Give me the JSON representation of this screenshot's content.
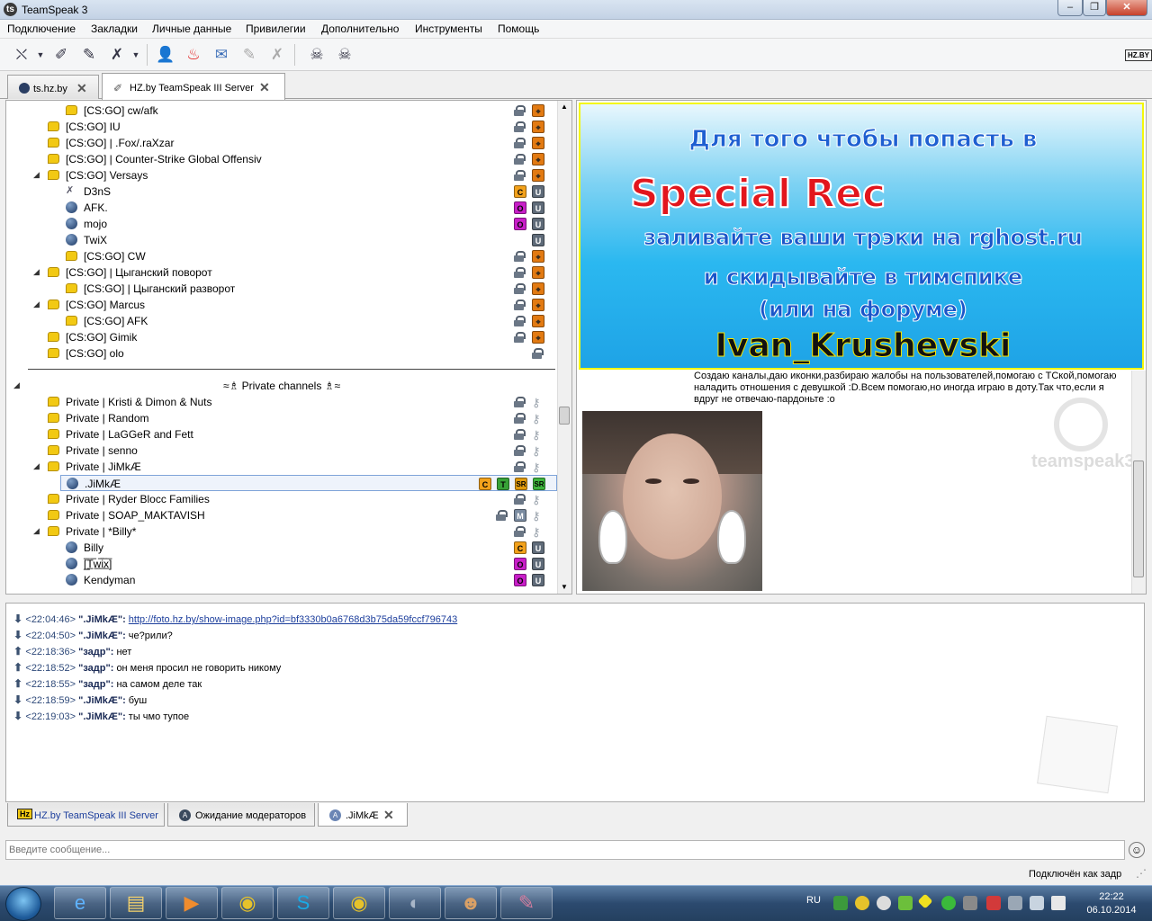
{
  "window": {
    "title": "TeamSpeak 3"
  },
  "menu": [
    "Подключение",
    "Закладки",
    "Личные данные",
    "Привилегии",
    "Дополнительно",
    "Инструменты",
    "Помощь"
  ],
  "toolbar_icons": [
    "connect-icon",
    "disconnect-icon",
    "away-icon",
    "mute-mic-icon",
    "mute-speaker-icon",
    "contacts-icon",
    "fire-icon",
    "chat-icon",
    "register-icon",
    "unregister-icon",
    "bug-icon",
    "bug2-icon"
  ],
  "toolbar_brand": "HZ.BY",
  "server_tabs": [
    {
      "label": "ts.hz.by"
    },
    {
      "label": "HZ.by TeamSpeak III Server"
    }
  ],
  "tree": [
    {
      "label": "[CS:GO] cw/afk",
      "kind": "channel",
      "indent": 2,
      "arrow": ""
    },
    {
      "label": "[CS:GO] IU",
      "kind": "channel",
      "indent": 1,
      "arrow": ""
    },
    {
      "label": "[CS:GO] | .Fox/.raXzar",
      "kind": "channel",
      "indent": 1,
      "arrow": ""
    },
    {
      "label": "[CS:GO] | Counter-Strike Global Offensiv",
      "kind": "channel",
      "indent": 1,
      "arrow": ""
    },
    {
      "label": "[CS:GO] Versays",
      "kind": "channel",
      "indent": 1,
      "arrow": "◢"
    },
    {
      "label": "D3nS",
      "kind": "user-muted",
      "indent": 2,
      "arrow": ""
    },
    {
      "label": "AFK.",
      "kind": "user",
      "indent": 2,
      "arrow": ""
    },
    {
      "label": "mojo",
      "kind": "user",
      "indent": 2,
      "arrow": ""
    },
    {
      "label": "TwiX",
      "kind": "user",
      "indent": 2,
      "arrow": ""
    },
    {
      "label": "[CS:GO] CW",
      "kind": "channel",
      "indent": 2,
      "arrow": ""
    },
    {
      "label": "[CS:GO] | Цыганский поворот",
      "kind": "channel",
      "indent": 1,
      "arrow": "◢"
    },
    {
      "label": "[CS:GO] | Цыганский разворот",
      "kind": "channel",
      "indent": 2,
      "arrow": ""
    },
    {
      "label": "[CS:GO] Marcus",
      "kind": "channel",
      "indent": 1,
      "arrow": "◢"
    },
    {
      "label": "[CS:GO] AFK",
      "kind": "channel",
      "indent": 2,
      "arrow": ""
    },
    {
      "label": "[CS:GO] Gimik",
      "kind": "channel",
      "indent": 1,
      "arrow": ""
    },
    {
      "label": "[CS:GO] olo",
      "kind": "channel",
      "indent": 1,
      "arrow": ""
    },
    {
      "label": "",
      "kind": "spacer",
      "indent": 0,
      "arrow": ""
    },
    {
      "label": "≈♗ Private channels ♗≈",
      "kind": "spacer-label",
      "indent": 0,
      "arrow": "◢"
    },
    {
      "label": "Private | Kristi & Dimon & Nuts",
      "kind": "channel",
      "indent": 1,
      "arrow": ""
    },
    {
      "label": "Private | Random",
      "kind": "channel",
      "indent": 1,
      "arrow": ""
    },
    {
      "label": "Private | LaGGeR and Fett",
      "kind": "channel",
      "indent": 1,
      "arrow": ""
    },
    {
      "label": "Private | senno",
      "kind": "channel",
      "indent": 1,
      "arrow": ""
    },
    {
      "label": "Private | JiMkÆ",
      "kind": "channel",
      "indent": 1,
      "arrow": "◢"
    },
    {
      "label": ".JiMkÆ",
      "kind": "user-selected",
      "indent": 2,
      "arrow": ""
    },
    {
      "label": "Private | Ryder Blocc Families",
      "kind": "channel",
      "indent": 1,
      "arrow": ""
    },
    {
      "label": "Private | SOAP_MAKTAVISH",
      "kind": "channel",
      "indent": 1,
      "arrow": ""
    },
    {
      "label": "Private | *Billy*",
      "kind": "channel",
      "indent": 1,
      "arrow": "◢"
    },
    {
      "label": "Billy",
      "kind": "user",
      "indent": 2,
      "arrow": ""
    },
    {
      "label": "[̲̅T̲̅w̲̅i̲̅x̲̅]",
      "kind": "user",
      "indent": 2,
      "arrow": ""
    },
    {
      "label": "Kendyman",
      "kind": "user",
      "indent": 2,
      "arrow": ""
    }
  ],
  "badges": {
    "row0": [
      "lock",
      "k"
    ],
    "row1": [
      "lock",
      "k"
    ],
    "row2": [
      "lock",
      "k"
    ],
    "row3": [
      "lock",
      "k"
    ],
    "row4": [
      "lock",
      "k"
    ],
    "row5": [
      "C",
      "U"
    ],
    "row6": [
      "O",
      "U"
    ],
    "row7": [
      "O",
      "U"
    ],
    "row8": [
      "U"
    ],
    "row9": [
      "lock",
      "k"
    ],
    "row10": [
      "lock",
      "k"
    ],
    "row11": [
      "lock",
      "k"
    ],
    "row12": [
      "lock",
      "k"
    ],
    "row13": [
      "lock",
      "k"
    ],
    "row14": [
      "lock",
      "k"
    ],
    "row15": [
      "lock"
    ],
    "row18": [
      "lock",
      "key"
    ],
    "row19": [
      "lock",
      "key"
    ],
    "row20": [
      "lock",
      "key"
    ],
    "row21": [
      "lock",
      "key"
    ],
    "row22": [
      "lock",
      "key"
    ],
    "row23": [
      "C",
      "T",
      "SR",
      "SR"
    ],
    "row24": [
      "lock",
      "key"
    ],
    "row25": [
      "lock",
      "M",
      "key"
    ],
    "row26": [
      "lock",
      "key"
    ],
    "row27": [
      "C",
      "U"
    ],
    "row28": [
      "O",
      "U"
    ],
    "row29": [
      "O",
      "U"
    ]
  },
  "banner": {
    "line1": "Для того чтобы попасть в",
    "line2": "Special Rec",
    "line3": "заливайте ваши трэки на rghost.ru",
    "line4": "и скидывайте  в тимспике",
    "line5": "(или на форуме)",
    "line6": "Ivan_Krushevski"
  },
  "info_description": "Создаю каналы,даю иконки,разбираю жалобы на пользователей,помогаю с ТСкой,помогаю наладить отношения с девушкой :D.Всем помогаю,но иногда играю в доту.Так что,если я вдруг не отвечаю-пардоньте :o",
  "info_logo": "teamspeak3",
  "chat": [
    {
      "dir": "in",
      "time": "<22:04:46>",
      "nick": "\".JiMkÆ\":",
      "text": "",
      "link": "http://foto.hz.by/show-image.php?id=bf3330b0a6768d3b75da59fccf796743"
    },
    {
      "dir": "in",
      "time": "<22:04:50>",
      "nick": "\".JiMkÆ\":",
      "text": "че?рили?",
      "link": ""
    },
    {
      "dir": "out",
      "time": "<22:18:36>",
      "nick": "\"задр\":",
      "text": "нет",
      "link": ""
    },
    {
      "dir": "out",
      "time": "<22:18:52>",
      "nick": "\"задр\":",
      "text": "он меня просил не говорить никому",
      "link": ""
    },
    {
      "dir": "out",
      "time": "<22:18:55>",
      "nick": "\"задр\":",
      "text": "на самом деле так",
      "link": ""
    },
    {
      "dir": "in",
      "time": "<22:18:59>",
      "nick": "\".JiMkÆ\":",
      "text": "буш",
      "link": ""
    },
    {
      "dir": "in",
      "time": "<22:19:03>",
      "nick": "\".JiMkÆ\":",
      "text": "ты чмо тупое",
      "link": ""
    }
  ],
  "chat_tabs": [
    {
      "label": "HZ.by TeamSpeak III Server",
      "icon": "Hz"
    },
    {
      "label": "Ожидание модераторов",
      "icon": "A"
    },
    {
      "label": ".JiMkÆ",
      "icon": "A"
    }
  ],
  "input": {
    "placeholder": "Введите сообщение..."
  },
  "status": "Подключён как задр",
  "taskbar": {
    "lang": "RU",
    "time": "22:22",
    "date": "06.10.2014"
  }
}
